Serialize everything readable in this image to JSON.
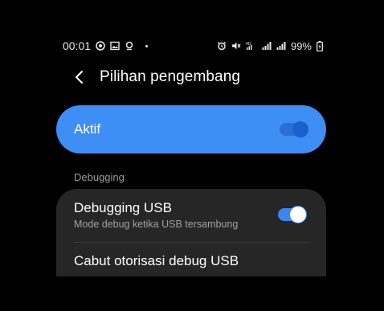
{
  "status_bar": {
    "time": "00:01",
    "left_icons": [
      "chrome-icon",
      "image-icon",
      "location-pin-icon"
    ],
    "right_icons": [
      "alarm-icon",
      "mute-icon",
      "4g-signal-icon",
      "signal-icon",
      "signal-icon-2",
      "battery-charging-icon"
    ],
    "network_label": "4G",
    "battery": "99%"
  },
  "header": {
    "title": "Pilihan pengembang"
  },
  "master_switch": {
    "label": "Aktif",
    "enabled": true
  },
  "sections": [
    {
      "header": "Debugging",
      "items": [
        {
          "title": "Debugging USB",
          "summary": "Mode debug ketika USB tersambung",
          "toggle": true
        },
        {
          "title": "Cabut otorisasi debug USB"
        }
      ]
    }
  ],
  "colors": {
    "background": "#000000",
    "accent": "#3d8ef5",
    "card": "#262626",
    "secondary_text": "#9a9a9a"
  }
}
